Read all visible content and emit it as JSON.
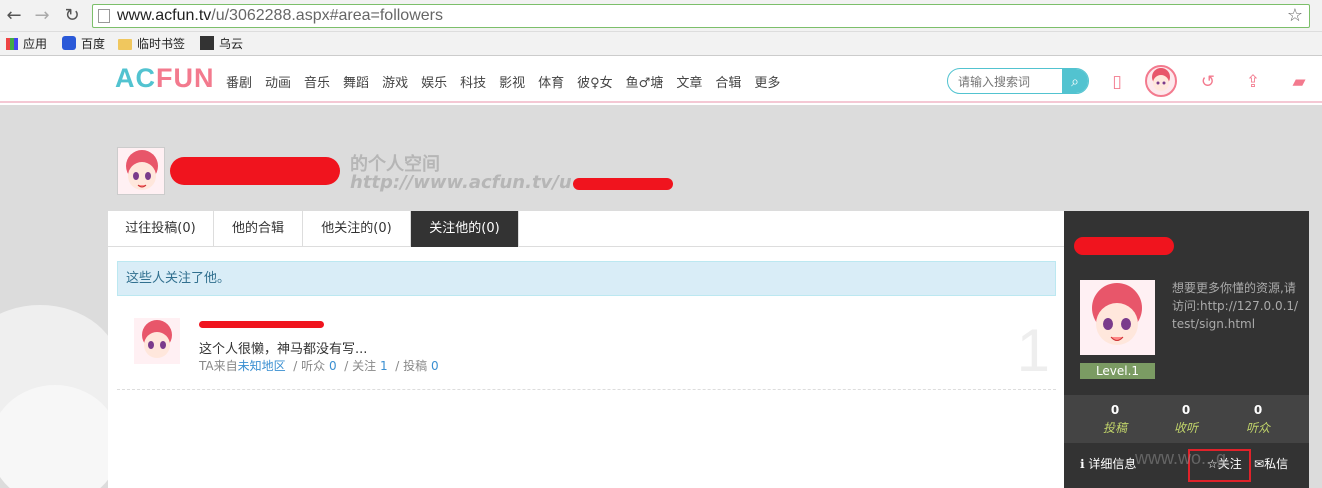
{
  "browser": {
    "url_host": "www.acfun.tv",
    "url_path": "/u/3062288.aspx#area=followers",
    "bookmarks": [
      "应用",
      "百度",
      "临时书签",
      "乌云"
    ]
  },
  "site": {
    "logo_a": "AC",
    "logo_b": "FUN",
    "menu": [
      "番剧",
      "动画",
      "音乐",
      "舞蹈",
      "游戏",
      "娱乐",
      "科技",
      "影视",
      "体育",
      "彼♀女",
      "鱼♂塘",
      "文章",
      "合辑",
      "更多"
    ],
    "search_placeholder": "请输入搜索词"
  },
  "space": {
    "title_suffix": "的个人空间",
    "url_prefix": "http://www.acfun.tv/u"
  },
  "tabs": [
    "过往投稿(0)",
    "他的合辑",
    "他关注的(0)",
    "关注他的(0)"
  ],
  "notice": "这些人关注了他。",
  "follower": {
    "bio": "这个人很懒，神马都没有写...",
    "from_label": "TA来自",
    "location": "未知地区",
    "listen_label": "听众",
    "listen_count": "0",
    "follow_label": "关注",
    "follow_count": "1",
    "post_label": "投稿",
    "post_count": "0",
    "index": "1"
  },
  "sidebar": {
    "description": "想要更多你懂的资源,请访问:http://127.0.0.1/test/sign.html",
    "level": "Level.1",
    "stats": [
      {
        "num": "0",
        "label": "投稿"
      },
      {
        "num": "0",
        "label": "收听"
      },
      {
        "num": "0",
        "label": "听众"
      }
    ],
    "details_label": "详细信息",
    "follow_label": "关注",
    "message_label": "私信"
  },
  "watermark": "www.wo...g"
}
